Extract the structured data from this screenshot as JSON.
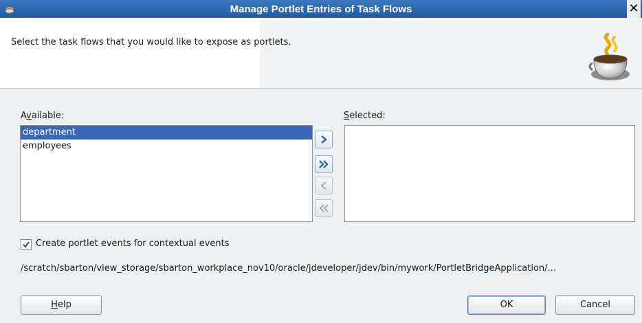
{
  "window": {
    "title": "Manage Portlet Entries of Task Flows"
  },
  "header": {
    "instruction": "Select the task flows that you would like to expose as portlets."
  },
  "available": {
    "label_pre": "A",
    "label_mnemonic": "v",
    "label_post": "ailable:",
    "items": [
      {
        "label": "department",
        "selected": true
      },
      {
        "label": "employees",
        "selected": false
      }
    ]
  },
  "selected": {
    "label_mnemonic": "S",
    "label_post": "elected:",
    "items": []
  },
  "shuttle": {
    "move": {
      "icon": "chevron-right-icon",
      "enabled": true
    },
    "move_all": {
      "icon": "double-chevron-right-icon",
      "enabled": true
    },
    "remove": {
      "icon": "chevron-left-icon",
      "enabled": false
    },
    "remove_all": {
      "icon": "double-chevron-left-icon",
      "enabled": false
    }
  },
  "options": {
    "contextual_events": {
      "label": "Create portlet events for contextual events",
      "checked": true
    }
  },
  "path": "/scratch/sbarton/view_storage/sbarton_workplace_nov10/oracle/jdeveloper/jdev/bin/mywork/PortletBridgeApplication/...",
  "buttons": {
    "help_mnemonic": "H",
    "help_rest": "elp",
    "ok": "OK",
    "cancel": "Cancel"
  },
  "colors": {
    "title_bar": "#2f69b0",
    "selection": "#3a68b8",
    "accent": "#1f5fb0"
  }
}
